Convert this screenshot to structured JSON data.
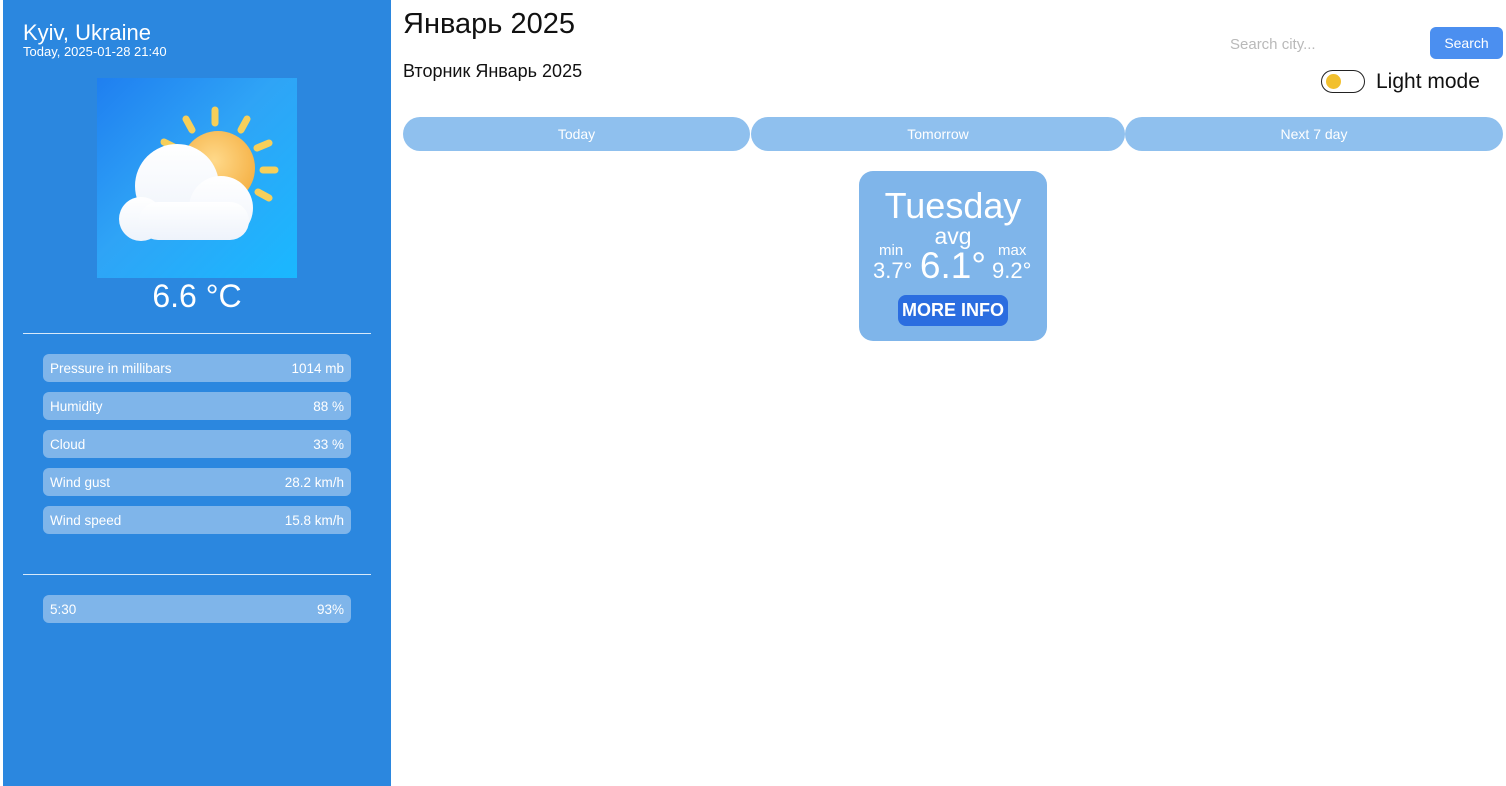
{
  "sidebar": {
    "city": "Kyiv, Ukraine",
    "datetime": "Today, 2025-01-28 21:40",
    "weather_icon": "partly-cloudy-icon",
    "temperature": "6.6 °C",
    "stats": [
      {
        "label": "Pressure in millibars",
        "value": "1014 mb"
      },
      {
        "label": "Humidity",
        "value": "88 %"
      },
      {
        "label": "Cloud",
        "value": "33 %"
      },
      {
        "label": "Wind gust",
        "value": "28.2 km/h"
      },
      {
        "label": "Wind speed",
        "value": "15.8 km/h"
      }
    ],
    "extra": {
      "label": "5:30",
      "value": "93%"
    }
  },
  "header": {
    "month_title": "Январь 2025",
    "sub_title": "Вторник Январь 2025",
    "search_placeholder": "Search city...",
    "search_button": "Search",
    "mode_label": "Light mode"
  },
  "tabs": [
    {
      "label": "Today"
    },
    {
      "label": "Tomorrow"
    },
    {
      "label": "Next 7 day"
    }
  ],
  "day_card": {
    "day": "Tuesday",
    "avg_label": "avg",
    "avg": "6.1°",
    "min_label": "min",
    "min": "3.7°",
    "max_label": "max",
    "max": "9.2°",
    "button": "MORE INFO"
  },
  "colors": {
    "sidebar_bg": "#2b87df",
    "row_bg": "#7fb5ea",
    "tab_bg": "#8fc0ee",
    "button_blue": "#4b8ff0",
    "more_info_blue": "#2b6de0",
    "toggle_knob": "#f2c02e"
  }
}
